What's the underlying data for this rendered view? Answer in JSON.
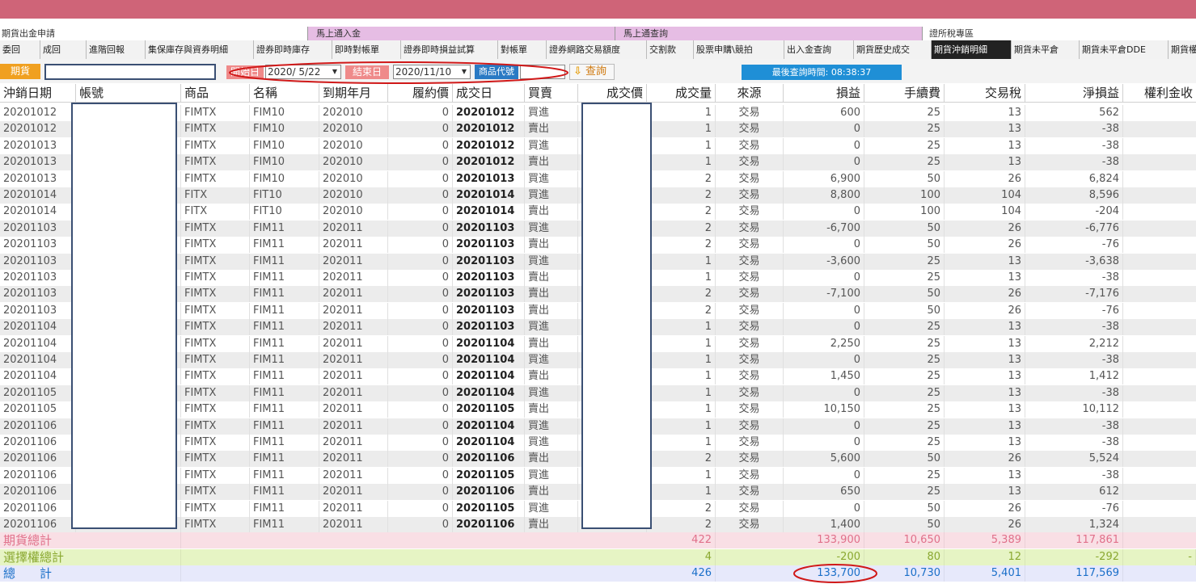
{
  "sections": [
    "期貨出金申請",
    "馬上通入金",
    "馬上通查詢",
    "證所稅專區"
  ],
  "subtabs": [
    "委回",
    "成回",
    "進階回報",
    "集保庫存與資券明細",
    "證券即時庫存",
    "即時對帳單",
    "證券即時損益試算",
    "對帳單",
    "證券網路交易額度",
    "交割款",
    "股票申購\\競拍",
    "出入金查詢",
    "期貨歷史成交",
    "期貨沖銷明細",
    "期貨未平倉",
    "期貨未平倉DDE",
    "期貨權"
  ],
  "filter": {
    "market_label": "期貨",
    "account_value": "",
    "start_label": "開始日",
    "start_date": "2020/ 5/22",
    "end_label": "結束日",
    "end_date": "2020/11/10",
    "product_label": "商品代號",
    "product_value": "",
    "query_label": "查詢",
    "last_query": "最後查詢時間: 08:38:37"
  },
  "columns": [
    "沖銷日期",
    "帳號",
    "商品",
    "名稱",
    "到期年月",
    "履約價",
    "成交日",
    "買賣",
    "成交價",
    "成交量",
    "來源",
    "損益",
    "手續費",
    "交易稅",
    "淨損益",
    "權利金收"
  ],
  "rows": [
    [
      "20201012",
      "",
      "FIMTX",
      "FIM10",
      "202010",
      "0",
      "20201012",
      "買進",
      "",
      "1",
      "交易",
      "600",
      "25",
      "13",
      "562"
    ],
    [
      "20201012",
      "",
      "FIMTX",
      "FIM10",
      "202010",
      "0",
      "20201012",
      "賣出",
      "",
      "1",
      "交易",
      "0",
      "25",
      "13",
      "-38"
    ],
    [
      "20201013",
      "",
      "FIMTX",
      "FIM10",
      "202010",
      "0",
      "20201012",
      "買進",
      "",
      "1",
      "交易",
      "0",
      "25",
      "13",
      "-38"
    ],
    [
      "20201013",
      "",
      "FIMTX",
      "FIM10",
      "202010",
      "0",
      "20201012",
      "賣出",
      "",
      "1",
      "交易",
      "0",
      "25",
      "13",
      "-38"
    ],
    [
      "20201013",
      "",
      "FIMTX",
      "FIM10",
      "202010",
      "0",
      "20201013",
      "買進",
      "",
      "2",
      "交易",
      "6,900",
      "50",
      "26",
      "6,824"
    ],
    [
      "20201014",
      "",
      "FITX",
      "FIT10",
      "202010",
      "0",
      "20201014",
      "買進",
      "",
      "2",
      "交易",
      "8,800",
      "100",
      "104",
      "8,596"
    ],
    [
      "20201014",
      "",
      "FITX",
      "FIT10",
      "202010",
      "0",
      "20201014",
      "賣出",
      "",
      "2",
      "交易",
      "0",
      "100",
      "104",
      "-204"
    ],
    [
      "20201103",
      "",
      "FIMTX",
      "FIM11",
      "202011",
      "0",
      "20201103",
      "買進",
      "",
      "2",
      "交易",
      "-6,700",
      "50",
      "26",
      "-6,776"
    ],
    [
      "20201103",
      "",
      "FIMTX",
      "FIM11",
      "202011",
      "0",
      "20201103",
      "賣出",
      "",
      "2",
      "交易",
      "0",
      "50",
      "26",
      "-76"
    ],
    [
      "20201103",
      "",
      "FIMTX",
      "FIM11",
      "202011",
      "0",
      "20201103",
      "買進",
      "",
      "1",
      "交易",
      "-3,600",
      "25",
      "13",
      "-3,638"
    ],
    [
      "20201103",
      "",
      "FIMTX",
      "FIM11",
      "202011",
      "0",
      "20201103",
      "賣出",
      "",
      "1",
      "交易",
      "0",
      "25",
      "13",
      "-38"
    ],
    [
      "20201103",
      "",
      "FIMTX",
      "FIM11",
      "202011",
      "0",
      "20201103",
      "賣出",
      "",
      "2",
      "交易",
      "-7,100",
      "50",
      "26",
      "-7,176"
    ],
    [
      "20201103",
      "",
      "FIMTX",
      "FIM11",
      "202011",
      "0",
      "20201103",
      "賣出",
      "",
      "2",
      "交易",
      "0",
      "50",
      "26",
      "-76"
    ],
    [
      "20201104",
      "",
      "FIMTX",
      "FIM11",
      "202011",
      "0",
      "20201103",
      "買進",
      "",
      "1",
      "交易",
      "0",
      "25",
      "13",
      "-38"
    ],
    [
      "20201104",
      "",
      "FIMTX",
      "FIM11",
      "202011",
      "0",
      "20201104",
      "賣出",
      "",
      "1",
      "交易",
      "2,250",
      "25",
      "13",
      "2,212"
    ],
    [
      "20201104",
      "",
      "FIMTX",
      "FIM11",
      "202011",
      "0",
      "20201104",
      "買進",
      "",
      "1",
      "交易",
      "0",
      "25",
      "13",
      "-38"
    ],
    [
      "20201104",
      "",
      "FIMTX",
      "FIM11",
      "202011",
      "0",
      "20201104",
      "賣出",
      "",
      "1",
      "交易",
      "1,450",
      "25",
      "13",
      "1,412"
    ],
    [
      "20201105",
      "",
      "FIMTX",
      "FIM11",
      "202011",
      "0",
      "20201104",
      "買進",
      "",
      "1",
      "交易",
      "0",
      "25",
      "13",
      "-38"
    ],
    [
      "20201105",
      "",
      "FIMTX",
      "FIM11",
      "202011",
      "0",
      "20201105",
      "賣出",
      "",
      "1",
      "交易",
      "10,150",
      "25",
      "13",
      "10,112"
    ],
    [
      "20201106",
      "",
      "FIMTX",
      "FIM11",
      "202011",
      "0",
      "20201104",
      "買進",
      "",
      "1",
      "交易",
      "0",
      "25",
      "13",
      "-38"
    ],
    [
      "20201106",
      "",
      "FIMTX",
      "FIM11",
      "202011",
      "0",
      "20201104",
      "買進",
      "",
      "1",
      "交易",
      "0",
      "25",
      "13",
      "-38"
    ],
    [
      "20201106",
      "",
      "FIMTX",
      "FIM11",
      "202011",
      "0",
      "20201106",
      "賣出",
      "",
      "2",
      "交易",
      "5,600",
      "50",
      "26",
      "5,524"
    ],
    [
      "20201106",
      "",
      "FIMTX",
      "FIM11",
      "202011",
      "0",
      "20201105",
      "買進",
      "",
      "1",
      "交易",
      "0",
      "25",
      "13",
      "-38"
    ],
    [
      "20201106",
      "",
      "FIMTX",
      "FIM11",
      "202011",
      "0",
      "20201106",
      "賣出",
      "",
      "1",
      "交易",
      "650",
      "25",
      "13",
      "612"
    ],
    [
      "20201106",
      "",
      "FIMTX",
      "FIM11",
      "202011",
      "0",
      "20201105",
      "買進",
      "",
      "2",
      "交易",
      "0",
      "50",
      "26",
      "-76"
    ],
    [
      "20201106",
      "",
      "FIMTX",
      "FIM11",
      "202011",
      "0",
      "20201106",
      "賣出",
      "",
      "2",
      "交易",
      "1,400",
      "50",
      "26",
      "1,324"
    ]
  ],
  "totals": [
    {
      "label": "期貨總計",
      "qty": "422",
      "pnl": "133,900",
      "fee": "10,650",
      "tax": "5,389",
      "net": "117,861",
      "color": "#e0708a",
      "bg": "#f9dfe5"
    },
    {
      "label": "選擇權總計",
      "qty": "4",
      "pnl": "-200",
      "fee": "80",
      "tax": "12",
      "net": "-292",
      "tail": "-",
      "color": "#8aa830",
      "bg": "#e6f4c4"
    },
    {
      "label": "總　　計",
      "qty": "426",
      "pnl": "133,700",
      "fee": "10,730",
      "tax": "5,401",
      "net": "117,569",
      "color": "#1a6fc9",
      "bg": "#e7e9fb"
    }
  ],
  "colors": {
    "topbar": "#cf6478",
    "section_bg": "#e6bde4",
    "highlight_oval": "#d01818",
    "mask_border": "#3a4f73"
  }
}
